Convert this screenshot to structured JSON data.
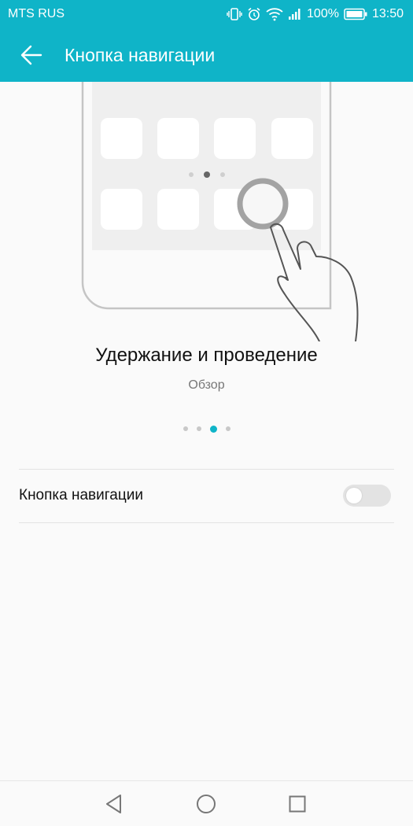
{
  "status_bar": {
    "carrier": "MTS RUS",
    "battery": "100%",
    "time": "13:50",
    "icons": [
      "vibrate-icon",
      "alarm-icon",
      "wifi-icon",
      "signal-icon",
      "battery-icon"
    ]
  },
  "app_bar": {
    "title": "Кнопка навигации",
    "back_icon": "arrow-back-icon"
  },
  "gesture": {
    "title": "Удержание и проведение",
    "subtitle": "Обзор"
  },
  "pager": {
    "count": 4,
    "active_index": 2
  },
  "settings": {
    "nav_button_label": "Кнопка навигации",
    "nav_button_enabled": false
  },
  "nav_bar": {
    "buttons": [
      "back-triangle-icon",
      "home-circle-icon",
      "recents-square-icon"
    ]
  },
  "colors": {
    "accent": "#0fb4c8",
    "background": "#fafafa"
  }
}
